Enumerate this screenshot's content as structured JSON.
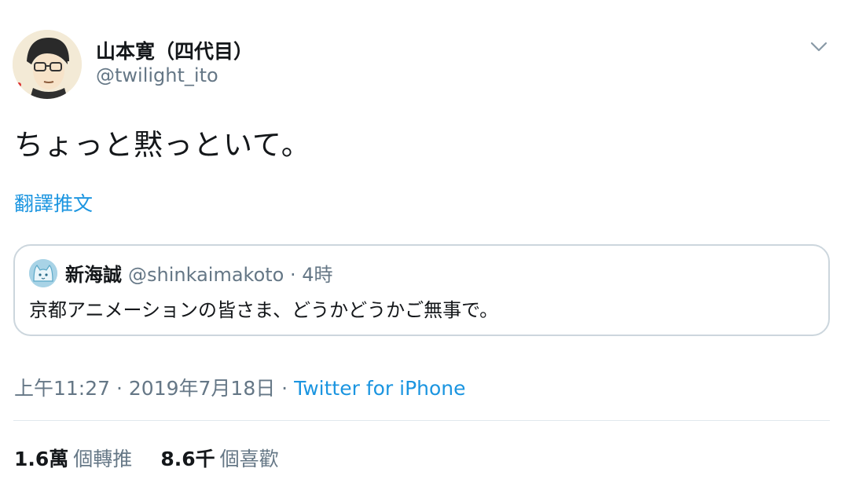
{
  "author": {
    "display_name": "山本寛（四代目）",
    "handle": "@twilight_ito"
  },
  "tweet": {
    "text": "ちょっと黙っといて。",
    "translate_label": "翻譯推文"
  },
  "quoted_tweet": {
    "display_name": "新海誠",
    "handle": "@shinkaimakoto",
    "separator": " · ",
    "time": "4時",
    "text": "京都アニメーションの皆さま、どうかどうかご無事で。"
  },
  "meta": {
    "time": "上午11:27",
    "sep1": " · ",
    "date": "2019年7月18日",
    "sep2": " · ",
    "source": "Twitter for iPhone"
  },
  "stats": {
    "retweets_count": "1.6萬",
    "retweets_label": "個轉推",
    "likes_count": "8.6千",
    "likes_label": "個喜歡"
  },
  "icons": {
    "more": "chevron-down-icon"
  },
  "colors": {
    "link": "#1b95e0",
    "secondary": "#657786",
    "border": "#ccd6dd"
  }
}
